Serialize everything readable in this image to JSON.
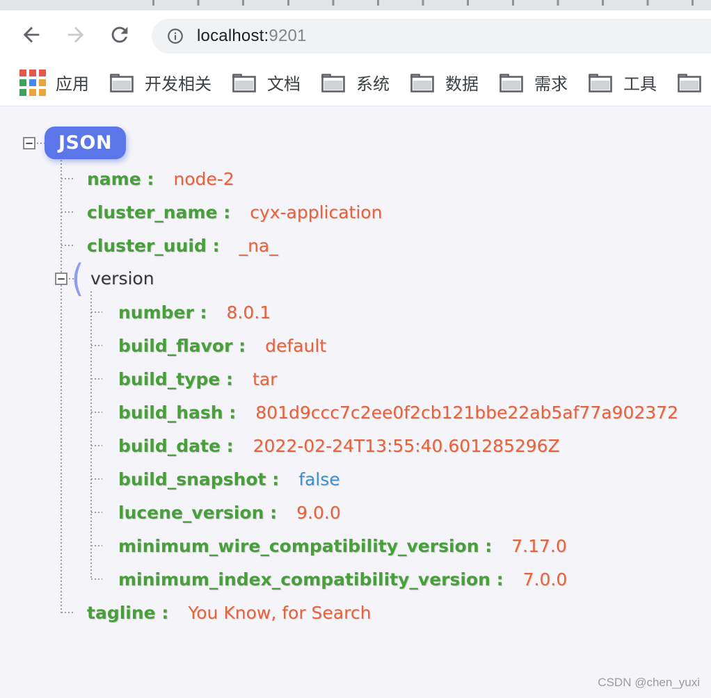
{
  "browser": {
    "url_host": "localhost:",
    "url_port": "9201",
    "bookmarks": [
      {
        "icon": "apps-grid-icon",
        "label": "应用"
      },
      {
        "icon": "folder-icon",
        "label": "开发相关"
      },
      {
        "icon": "folder-icon",
        "label": "文档"
      },
      {
        "icon": "folder-icon",
        "label": "系统"
      },
      {
        "icon": "folder-icon",
        "label": "数据"
      },
      {
        "icon": "folder-icon",
        "label": "需求"
      },
      {
        "icon": "folder-icon",
        "label": "工具"
      },
      {
        "icon": "folder-icon",
        "label": ""
      }
    ]
  },
  "tree": {
    "root_label": "JSON",
    "collapse_glyph": "−",
    "colon": " :",
    "object_bracket": "(",
    "object_label": "version",
    "level1_before_object": [
      {
        "key": "name",
        "value": "node-2",
        "vtype": "str",
        "level": "1"
      },
      {
        "key": "cluster_name",
        "value": "cyx-application",
        "vtype": "str",
        "level": "1"
      },
      {
        "key": "cluster_uuid",
        "value": "_na_",
        "vtype": "str",
        "level": "1"
      }
    ],
    "object_children": [
      {
        "key": "number",
        "value": "8.0.1",
        "vtype": "str",
        "level": "2"
      },
      {
        "key": "build_flavor",
        "value": "default",
        "vtype": "str",
        "level": "2"
      },
      {
        "key": "build_type",
        "value": "tar",
        "vtype": "str",
        "level": "2"
      },
      {
        "key": "build_hash",
        "value": "801d9ccc7c2ee0f2cb121bbe22ab5af77a902372",
        "vtype": "str",
        "level": "2"
      },
      {
        "key": "build_date",
        "value": "2022-02-24T13:55:40.601285296Z",
        "vtype": "str",
        "level": "2"
      },
      {
        "key": "build_snapshot",
        "value": "false",
        "vtype": "bool",
        "level": "2"
      },
      {
        "key": "lucene_version",
        "value": "9.0.0",
        "vtype": "str",
        "level": "2"
      },
      {
        "key": "minimum_wire_compatibility_version",
        "value": "7.17.0",
        "vtype": "str",
        "level": "2"
      },
      {
        "key": "minimum_index_compatibility_version",
        "value": "7.0.0",
        "vtype": "str",
        "level": "2"
      }
    ],
    "level1_after_object": [
      {
        "key": "tagline",
        "value": "You Know, for Search",
        "vtype": "str",
        "level": "1"
      }
    ]
  },
  "watermark": "CSDN @chen_yuxi",
  "colors": {
    "badge_blue": "#5b76e8",
    "key_green": "#48a03a",
    "value_orange": "#e7633c",
    "bool_blue": "#3f92d2",
    "chrome_icon_gray": "#5f6368"
  }
}
